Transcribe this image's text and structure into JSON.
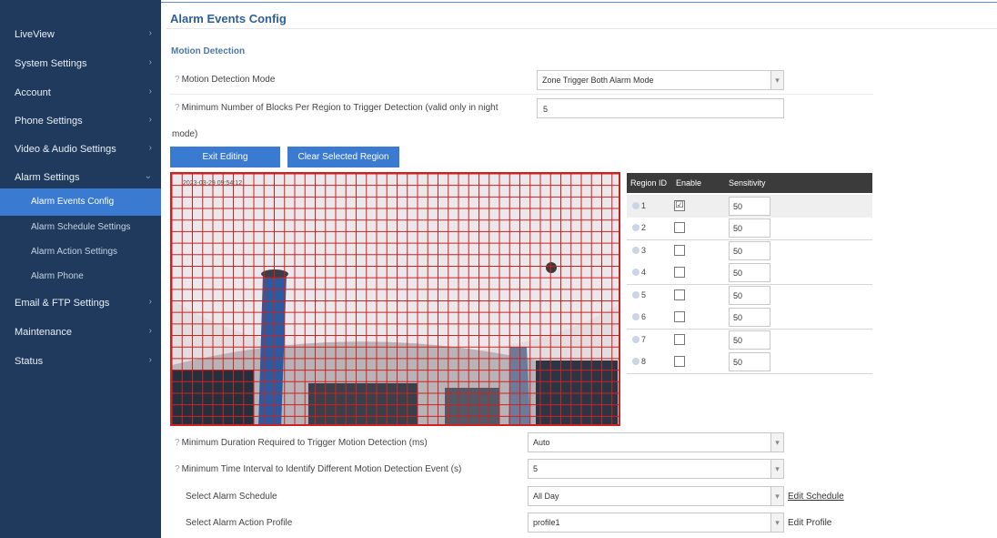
{
  "sidebar": {
    "items": [
      {
        "label": "LiveView",
        "chevron": "›"
      },
      {
        "label": "System Settings",
        "chevron": "›"
      },
      {
        "label": "Account",
        "chevron": "›"
      },
      {
        "label": "Phone Settings",
        "chevron": "›"
      },
      {
        "label": "Video & Audio Settings",
        "chevron": "›"
      },
      {
        "label": "Alarm Settings",
        "chevron": "⌄"
      },
      {
        "label": "Alarm Events Config"
      },
      {
        "label": "Alarm Schedule Settings"
      },
      {
        "label": "Alarm Action Settings"
      },
      {
        "label": "Alarm Phone"
      },
      {
        "label": "Email & FTP Settings",
        "chevron": "›"
      },
      {
        "label": "Maintenance",
        "chevron": "›"
      },
      {
        "label": "Status",
        "chevron": "›"
      }
    ]
  },
  "page": {
    "title": "Alarm Events Config",
    "section": "Motion Detection"
  },
  "form": {
    "mode_label": "Motion Detection Mode",
    "mode_value": "Zone Trigger Both Alarm Mode",
    "min_blocks_label": "Minimum Number of Blocks Per Region to Trigger Detection (valid only in night",
    "min_blocks_label_cont": "mode)",
    "min_blocks_value": "5",
    "exit_editing": "Exit Editing",
    "clear_region": "Clear Selected Region",
    "min_duration_label": "Minimum Duration Required to Trigger Motion Detection (ms)",
    "min_duration_value": "Auto",
    "min_interval_label": "Minimum Time Interval to Identify Different Motion Detection Event (s)",
    "min_interval_value": "5",
    "schedule_label": "Select Alarm Schedule",
    "schedule_value": "All Day",
    "edit_schedule": "Edit Schedule",
    "profile_label": "Select Alarm Action Profile",
    "profile_value": "profile1",
    "edit_profile": "Edit Profile"
  },
  "video": {
    "overlay_text": "2023-03-29 09:54:12"
  },
  "regions": {
    "headers": [
      "Region ID",
      "Enable",
      "Sensitivity"
    ],
    "rows": [
      {
        "id": "1",
        "enabled": "☑",
        "sensitivity": "50"
      },
      {
        "id": "2",
        "enabled": "",
        "sensitivity": "50"
      },
      {
        "id": "3",
        "enabled": "",
        "sensitivity": "50"
      },
      {
        "id": "4",
        "enabled": "",
        "sensitivity": "50"
      },
      {
        "id": "5",
        "enabled": "",
        "sensitivity": "50"
      },
      {
        "id": "6",
        "enabled": "",
        "sensitivity": "50"
      },
      {
        "id": "7",
        "enabled": "",
        "sensitivity": "50"
      },
      {
        "id": "8",
        "enabled": "",
        "sensitivity": "50"
      }
    ]
  },
  "colors": {
    "sidebar_bg": "#1f3a5c",
    "accent": "#3a7ad1",
    "grid_line": "#cc2222"
  }
}
